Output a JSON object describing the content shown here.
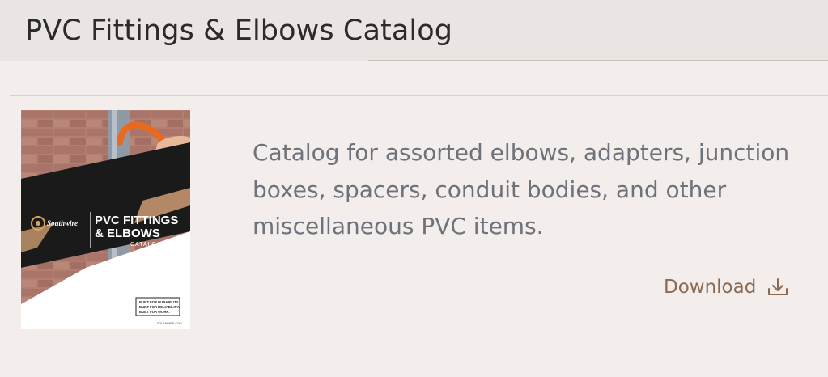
{
  "header": {
    "title": "PVC Fittings & Elbows Catalog"
  },
  "card": {
    "description": "Catalog for assorted elbows, adapters, junction boxes, spacers, conduit bodies, and other miscellaneous PVC items.",
    "download_label": "Download",
    "download_icon": "download-icon",
    "cover": {
      "brand": "Southwire",
      "title_line1": "PVC FITTINGS",
      "title_line2": "& ELBOWS",
      "subtitle": "CATALOG",
      "tagline_line1": "BUILT FOR DURABILITY.",
      "tagline_line2": "BUILT FOR RELIABILITY.",
      "tagline_line3": "BUILT FOR WORK.",
      "url": "SOUTHWIRE.COM"
    }
  },
  "colors": {
    "link": "#8c6a52",
    "text": "#6e727a",
    "title": "#2b2b2b",
    "background": "#f3eeeb"
  }
}
